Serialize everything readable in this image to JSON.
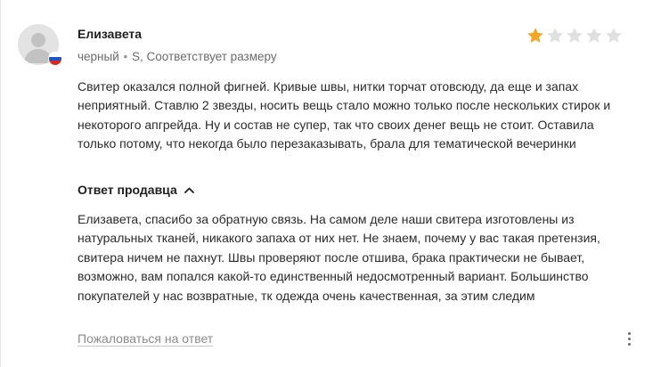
{
  "review": {
    "author": "Елизавета",
    "variant": "черный",
    "separator": "•",
    "size_fit": "S, Соответствует размеру",
    "rating": 1,
    "max_rating": 5,
    "star_color_filled": "#f5a623",
    "star_color_empty": "#e0e0e0",
    "text": "Свитер оказался полной фигней. Кривые швы, нитки торчат отовсюду, да еще и запах неприятный. Ставлю 2 звезды, носить вещь стало можно только после нескольких стирок и некоторого апгрейда. Ну и состав не супер, так что своих денег вещь не стоит. Оставила только потому, что некогда было перезаказывать, брала для тематической вечеринки"
  },
  "seller_reply": {
    "toggle_label": "Ответ продавца",
    "toggle_icon": "chevron-up-icon",
    "text": "Елизавета, спасибо за обратную связь. На самом деле наши свитера изготовлены из натуральных тканей, никакого запаха от них нет. Не знаем, почему у вас такая претензия, свитера ничем не пахнут. Швы проверяют после отшива, брака практически не бывает, возможно, вам попался какой-то единственный недосмотренный вариант. Большинство покупателей у нас возвратные, тк одежда очень качественная, за этим следим"
  },
  "actions": {
    "report_label": "Пожаловаться на ответ",
    "more_icon": "more-vertical-icon"
  },
  "flag": {
    "icon": "russia-flag-icon",
    "colors": [
      "#ffffff",
      "#1c57c9",
      "#d52b1e"
    ]
  }
}
